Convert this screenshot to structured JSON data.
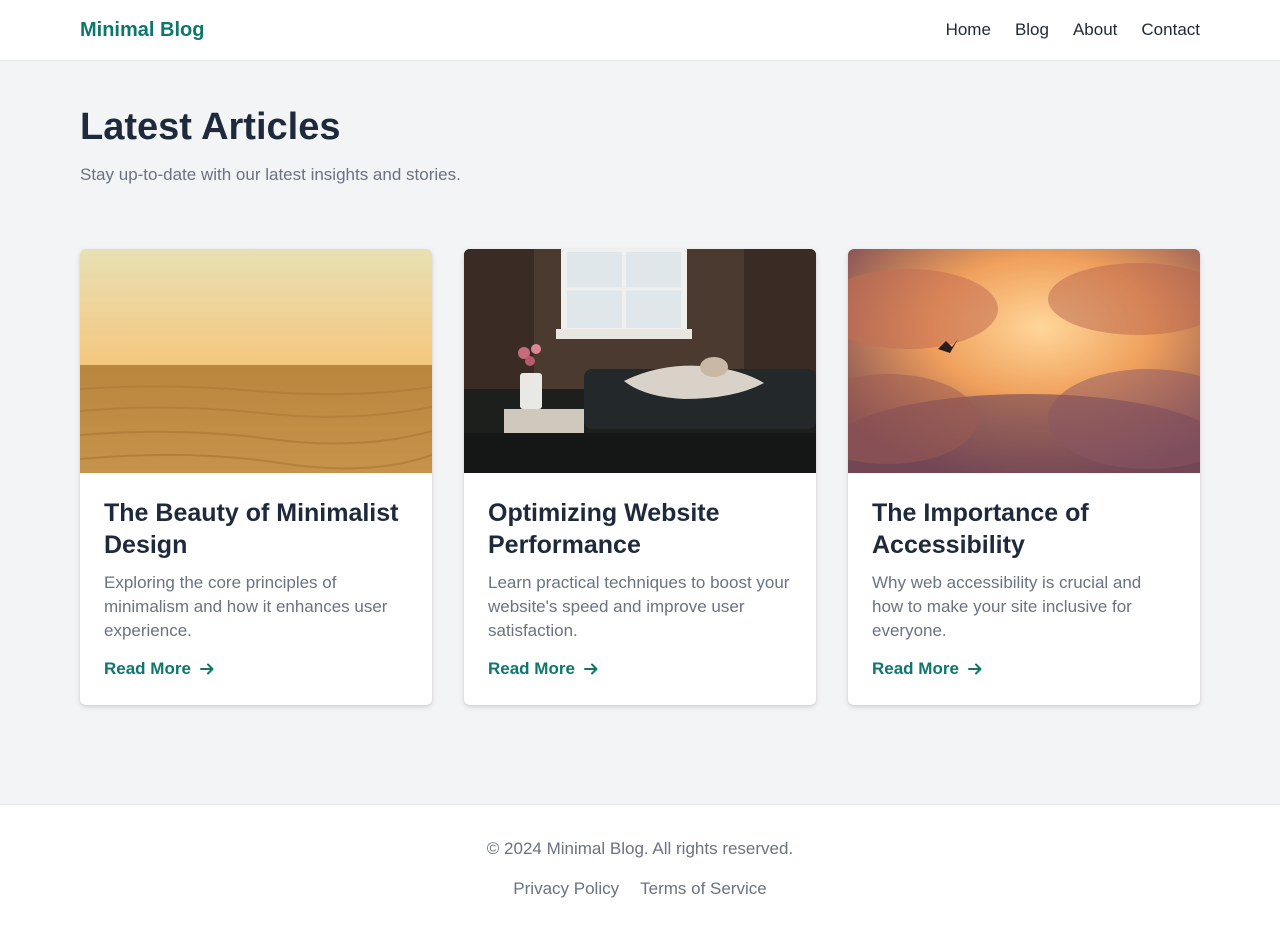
{
  "header": {
    "logo": "Minimal Blog",
    "nav": [
      {
        "label": "Home"
      },
      {
        "label": "Blog"
      },
      {
        "label": "About"
      },
      {
        "label": "Contact"
      }
    ]
  },
  "main": {
    "title": "Latest Articles",
    "subtitle": "Stay up-to-date with our latest insights and stories.",
    "articles": [
      {
        "title": "The Beauty of Minimalist Design",
        "excerpt": "Exploring the core principles of minimalism and how it enhances user experience.",
        "link": "Read More",
        "image": "desert-dunes-photo"
      },
      {
        "title": "Optimizing Website Performance",
        "excerpt": "Learn practical techniques to boost your website's speed and improve user satisfaction.",
        "link": "Read More",
        "image": "person-sleeping-by-window-photo"
      },
      {
        "title": "The Importance of Accessibility",
        "excerpt": "Why web accessibility is crucial and how to make your site inclusive for everyone.",
        "link": "Read More",
        "image": "sunset-clouds-bird-photo"
      }
    ]
  },
  "footer": {
    "copyright": "© 2024 Minimal Blog. All rights reserved.",
    "links": [
      {
        "label": "Privacy Policy"
      },
      {
        "label": "Terms of Service"
      }
    ]
  },
  "colors": {
    "accent": "#0f766e",
    "page_background": "#f3f4f6",
    "heading": "#1e293b",
    "muted_text": "#6b7280"
  }
}
